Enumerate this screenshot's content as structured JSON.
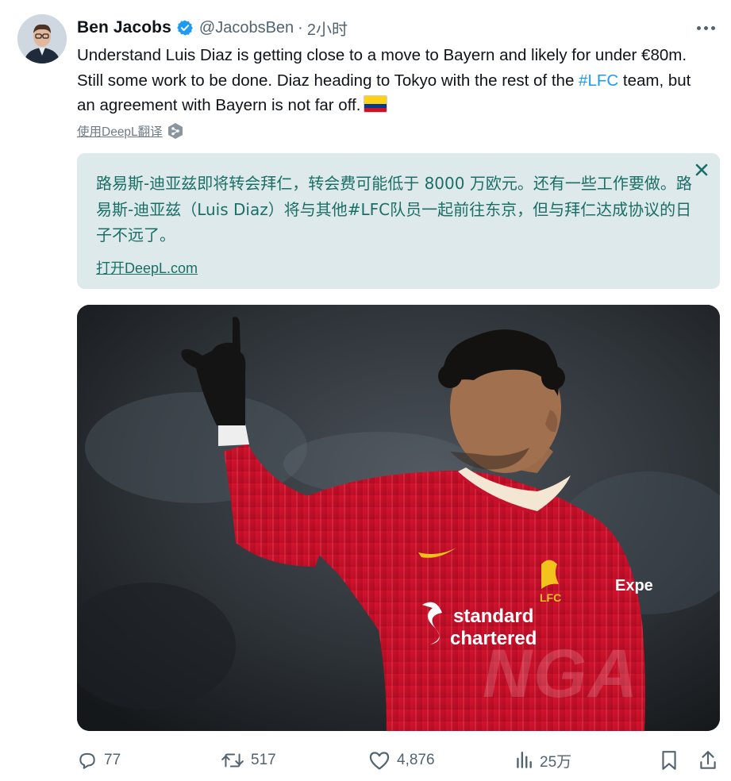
{
  "tweet": {
    "author_name": "Ben Jacobs",
    "handle": "@JacobsBen",
    "separator": "·",
    "time": "2小时",
    "text_before_hashtag": "Understand Luis Diaz is getting close to a move to Bayern and likely for under €80m. Still some work to be done. Diaz heading to Tokyo with the rest of the ",
    "hashtag": "#LFC",
    "text_after_hashtag": " team, but an agreement with Bayern is not far off.",
    "flag": "colombia-flag-emoji"
  },
  "translate": {
    "link_label": "使用DeepL翻译",
    "translation_text": "路易斯-迪亚兹即将转会拜仁，转会费可能低于 8000 万欧元。还有一些工作要做。路易斯-迪亚兹（Luis Diaz）将与其他#LFC队员一起前往东京，但与拜仁达成协议的日子不远了。",
    "open_link": "打开DeepL.com"
  },
  "media": {
    "watermark": "NGA",
    "sponsor_line1": "standard",
    "sponsor_line2": "chartered",
    "crest_text": "LFC",
    "sleeve_text": "Expe"
  },
  "actions": {
    "replies": "77",
    "reposts": "517",
    "likes": "4,876",
    "views": "25万"
  },
  "colors": {
    "accent": "#1d9bf0",
    "muted": "#536471",
    "deepl_bg": "#dde9eb",
    "deepl_text": "#1b6f66",
    "jersey": "#c8102e"
  }
}
